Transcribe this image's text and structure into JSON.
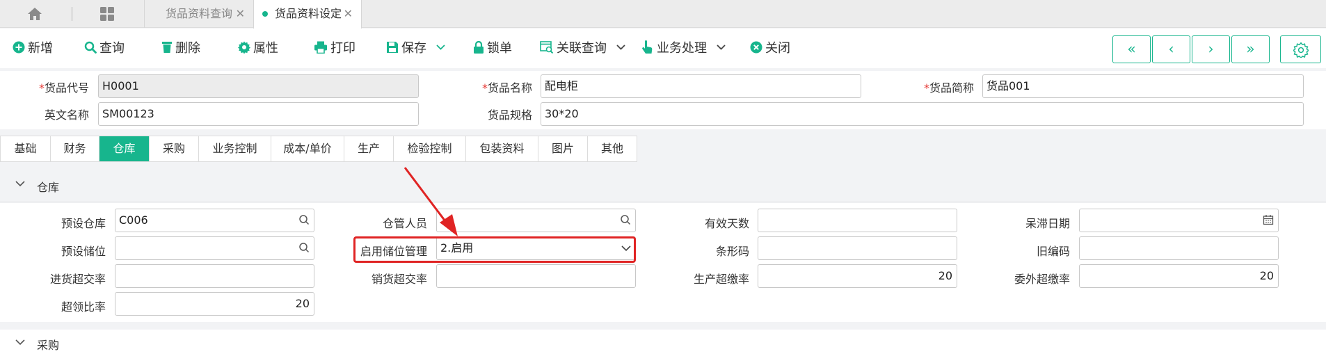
{
  "tabs": {
    "tab1": "货品资料查询",
    "tab2": "货品资料设定",
    "close": "✕"
  },
  "toolbar": {
    "add": "新增",
    "query": "查询",
    "delete": "删除",
    "properties": "属性",
    "print": "打印",
    "save": "保存",
    "lock": "锁单",
    "related_query": "关联查询",
    "business": "业务处理",
    "close": "关闭",
    "nav": {
      "first": "«",
      "prev": "‹",
      "next": "›",
      "last": "»"
    }
  },
  "header": {
    "code_label": "货品代号",
    "code_value": "H0001",
    "name_label": "货品名称",
    "name_value": "配电柜",
    "short_label": "货品简称",
    "short_value": "货品001",
    "en_label": "英文名称",
    "en_value": "SM00123",
    "spec_label": "货品规格",
    "spec_value": "30*20",
    "required_mark": "*"
  },
  "subtabs": [
    "基础",
    "财务",
    "仓库",
    "采购",
    "业务控制",
    "成本/单价",
    "生产",
    "检验控制",
    "包装资料",
    "图片",
    "其他"
  ],
  "active_subtab": "仓库",
  "warehouse": {
    "section_title": "仓库",
    "default_wh_label": "预设仓库",
    "default_wh_value": "C006",
    "keeper_label": "仓管人员",
    "keeper_value": "",
    "valid_days_label": "有效天数",
    "valid_days_value": "",
    "stale_date_label": "呆滞日期",
    "stale_date_value": "",
    "default_loc_label": "预设储位",
    "default_loc_value": "",
    "loc_mgmt_label": "启用储位管理",
    "loc_mgmt_value": "2.启用",
    "barcode_label": "条形码",
    "barcode_value": "",
    "old_code_label": "旧编码",
    "old_code_value": "",
    "purchase_over_label": "进货超交率",
    "purchase_over_value": "",
    "sales_over_label": "销货超交率",
    "sales_over_value": "",
    "prod_over_label": "生产超缴率",
    "prod_over_value": "20",
    "outsource_over_label": "委外超缴率",
    "outsource_over_value": "20",
    "overdraw_label": "超领比率",
    "overdraw_value": "20"
  },
  "purchase_section": {
    "title": "采购"
  },
  "colors": {
    "accent": "#17b58d",
    "highlight": "#e02424",
    "required": "#e53935"
  }
}
